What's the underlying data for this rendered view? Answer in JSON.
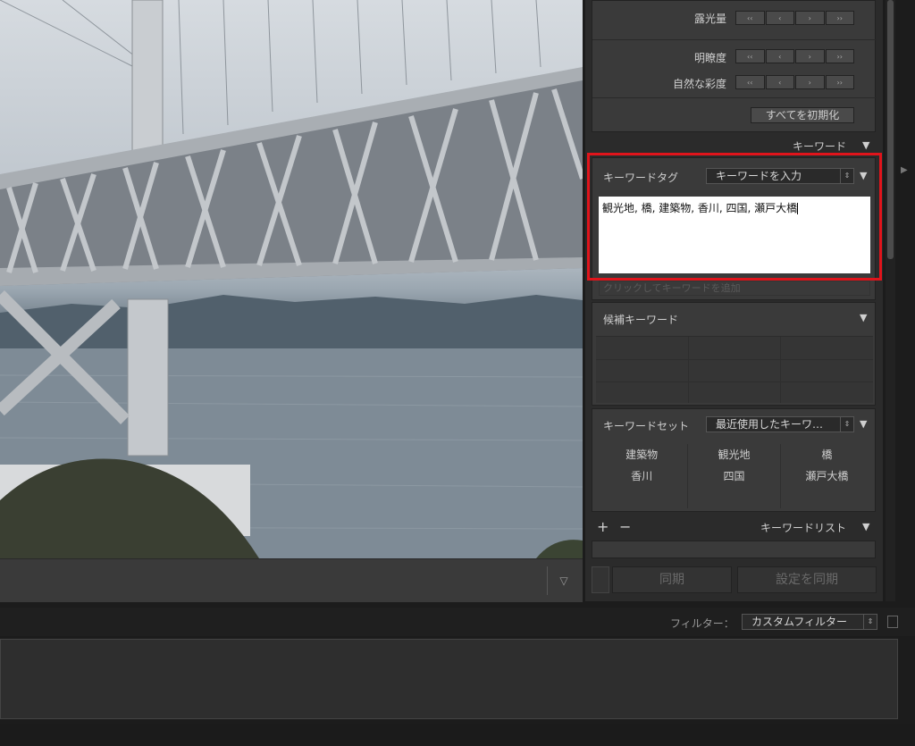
{
  "quick_develop": {
    "exposure_label": "露光量",
    "clarity_label": "明瞭度",
    "vibrance_label": "自然な彩度",
    "step_buttons": [
      "‹‹",
      "‹",
      "›",
      "››"
    ],
    "reset_all_label": "すべてを初期化"
  },
  "keyword_panel": {
    "title": "キーワード",
    "tag_label": "キーワードタグ",
    "tag_mode": "キーワードを入力",
    "keywords_text": "観光地, 橋, 建築物, 香川, 四国, 瀬戸大橋",
    "add_placeholder": "クリックしてキーワードを追加",
    "suggestions_label": "候補キーワード",
    "set_label": "キーワードセット",
    "set_mode": "最近使用したキーワ…",
    "set_items": [
      "建築物",
      "観光地",
      "橋",
      "香川",
      "四国",
      "瀬戸大橋"
    ]
  },
  "keyword_list": {
    "title": "キーワードリスト",
    "add": "+",
    "remove": "−"
  },
  "sync": {
    "sync_label": "同期",
    "sync_settings_label": "設定を同期"
  },
  "filter": {
    "label": "フィルター：",
    "value": "カスタムフィルター"
  },
  "icons": {
    "toolbar_toggle": "chevron-down-icon",
    "collapse_panel": "triangle-right-icon"
  },
  "colors": {
    "highlight": "#e0141b",
    "panel_bg": "#3a3a3a"
  }
}
